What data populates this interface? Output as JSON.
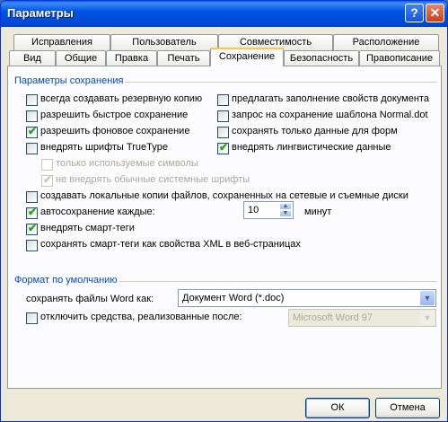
{
  "window": {
    "title": "Параметры",
    "help_icon": "?",
    "close_icon": "✕"
  },
  "tabs_row1": [
    "Исправления",
    "Пользователь",
    "Совместимость",
    "Расположение"
  ],
  "tabs_row2": [
    "Вид",
    "Общие",
    "Правка",
    "Печать",
    "Сохранение",
    "Безопасность",
    "Правописание"
  ],
  "active_tab": "Сохранение",
  "save_group": {
    "title": "Параметры сохранения",
    "left": [
      {
        "label": "всегда создавать резервную копию",
        "checked": false
      },
      {
        "label": "разрешить быстрое сохранение",
        "checked": false
      },
      {
        "label": "разрешить фоновое сохранение",
        "checked": true
      },
      {
        "label": "внедрять шрифты TrueType",
        "checked": false
      }
    ],
    "right": [
      {
        "label": "предлагать заполнение свойств документа",
        "checked": false
      },
      {
        "label": "запрос на сохранение шаблона Normal.dot",
        "checked": false
      },
      {
        "label": "сохранять только данные для форм",
        "checked": false
      },
      {
        "label": "внедрять лингвистические данные",
        "checked": true
      }
    ],
    "sub": [
      {
        "label": "только используемые символы",
        "checked": false
      },
      {
        "label": "не внедрять обычные системные шрифты",
        "checked": true
      }
    ],
    "bottom": [
      {
        "label": "создавать локальные копии файлов, сохраненных на сетевые и съемные диски",
        "checked": false
      },
      {
        "label": "автосохранение каждые:",
        "checked": true
      },
      {
        "label": "внедрять смарт-теги",
        "checked": true
      },
      {
        "label": "сохранять смарт-теги как свойства XML в веб-страницах",
        "checked": false
      }
    ],
    "autosave_value": "10",
    "autosave_unit": "минут"
  },
  "format_group": {
    "title": "Формат по умолчанию",
    "save_as_label": "сохранять файлы Word как:",
    "save_as_value": "Документ Word (*.doc)",
    "disable_label": "отключить средства, реализованные после:",
    "disable_checked": false,
    "disable_value": "Microsoft Word 97"
  },
  "buttons": {
    "ok": "ОК",
    "cancel": "Отмена"
  },
  "colors": {
    "title_bar": "#0054e3",
    "accent": "#0046d5",
    "check": "#21a121"
  }
}
